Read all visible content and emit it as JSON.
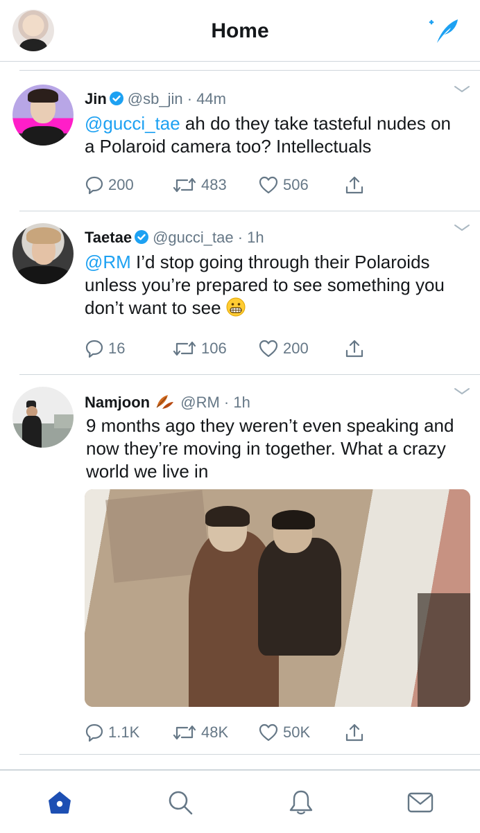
{
  "header": {
    "title": "Home"
  },
  "colors": {
    "accent": "#1da1f2",
    "text": "#14171a",
    "muted": "#657786",
    "divider": "#cfd6db",
    "tab_active": "#1da1f2"
  },
  "icons": {
    "compose": "feather-sparkle-icon",
    "verified": "verified-badge-icon",
    "reply": "speech-bubble-icon",
    "retweet": "retweet-arrows-icon",
    "like": "heart-icon",
    "share": "share-upload-icon",
    "tabs": [
      "home-icon",
      "search-icon",
      "bell-icon",
      "mail-icon"
    ]
  },
  "tweets": [
    {
      "name": "Jin",
      "verified": true,
      "handle": "@sb_jin",
      "time": "44m",
      "mention": "@gucci_tae",
      "text": " ah do they take tasteful nudes on a Polaroid camera too? Intellectuals",
      "replies": "200",
      "retweets": "483",
      "likes": "506"
    },
    {
      "name": "Taetae",
      "verified": true,
      "handle": "@gucci_tae",
      "time": "1h",
      "mention": "@RM",
      "text": " I’d stop going through their Polaroids unless you’re prepared to see something you don’t want to see",
      "emoji": "grimacing-face-emoji",
      "replies": "16",
      "retweets": "106",
      "likes": "200"
    },
    {
      "name": "Namjoon",
      "verified": false,
      "name_emoji": "fallen-leaves-emoji",
      "handle": "@RM",
      "time": "1h",
      "text": "9 months ago they weren’t even speaking and now they’re moving in together. What a crazy world we live in",
      "has_photo": true,
      "replies": "1.1K",
      "retweets": "48K",
      "likes": "50K"
    }
  ]
}
